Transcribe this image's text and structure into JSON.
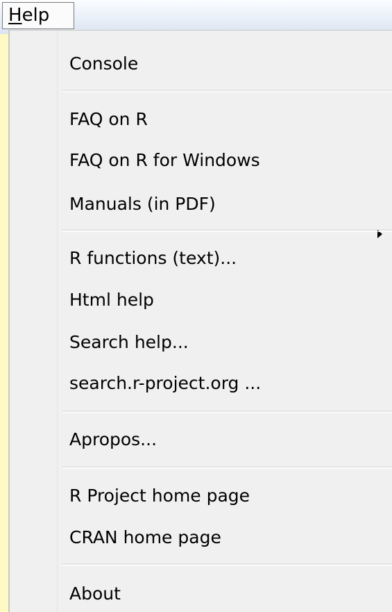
{
  "menu": {
    "title_mnemonic": "H",
    "title_rest": "elp"
  },
  "items": {
    "console": "Console",
    "faq_r": "FAQ on R",
    "faq_windows": "FAQ on R for Windows",
    "manuals": "Manuals (in PDF)",
    "r_functions": "R functions (text)...",
    "html_help": "Html help",
    "search_help": "Search help...",
    "search_site": "search.r-project.org ...",
    "apropos": "Apropos...",
    "r_project_home": "R Project home page",
    "cran_home": "CRAN home page",
    "about": "About"
  },
  "icons": {
    "submenu_arrow": "triangle-right-icon"
  },
  "colors": {
    "background": "#fff9c4",
    "menu_background": "#f0f0f0"
  }
}
